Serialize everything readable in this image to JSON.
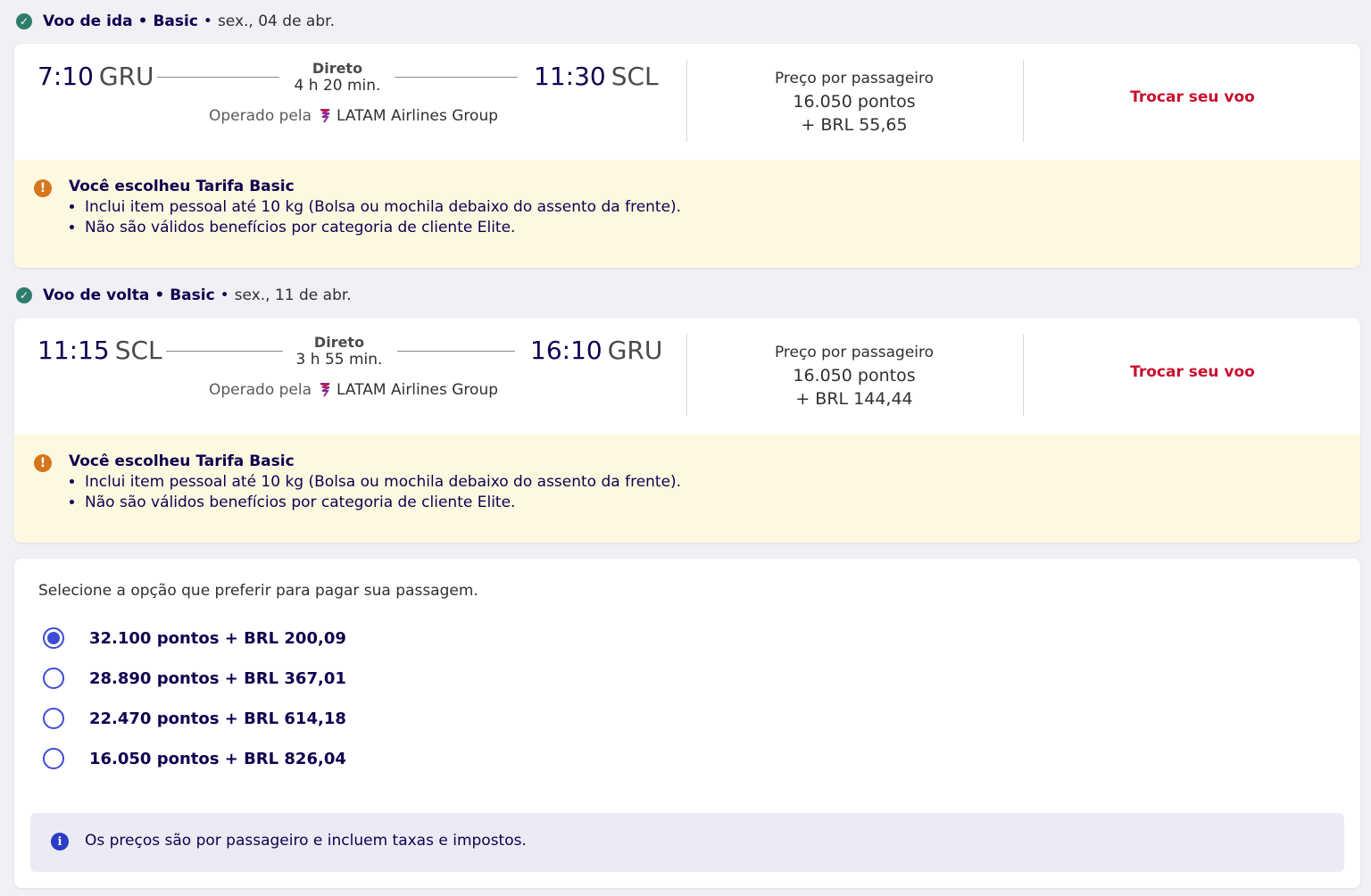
{
  "outbound": {
    "title": "Voo de ida",
    "fare": "Basic",
    "date": "sex., 04 de abr.",
    "dep_time": "7:10",
    "dep_code": "GRU",
    "arr_time": "11:30",
    "arr_code": "SCL",
    "direct_label": "Direto",
    "duration": "4 h 20 min.",
    "operated_by": "Operado pela",
    "airline": "LATAM Airlines Group",
    "price_label": "Preço por passageiro",
    "price_points": "16.050 pontos",
    "price_brl": "+ BRL 55,65",
    "change_label": "Trocar seu voo",
    "notice_title": "Você escolheu Tarifa Basic",
    "notice_items": [
      "Inclui item pessoal até 10 kg (Bolsa ou mochila debaixo do assento da frente).",
      "Não são válidos benefícios por categoria de cliente Elite."
    ]
  },
  "return": {
    "title": "Voo de volta",
    "fare": "Basic",
    "date": "sex., 11 de abr.",
    "dep_time": "11:15",
    "dep_code": "SCL",
    "arr_time": "16:10",
    "arr_code": "GRU",
    "direct_label": "Direto",
    "duration": "3 h 55 min.",
    "operated_by": "Operado pela",
    "airline": "LATAM Airlines Group",
    "price_label": "Preço por passageiro",
    "price_points": "16.050 pontos",
    "price_brl": "+ BRL 144,44",
    "change_label": "Trocar seu voo",
    "notice_title": "Você escolheu Tarifa Basic",
    "notice_items": [
      "Inclui item pessoal até 10 kg (Bolsa ou mochila debaixo do assento da frente).",
      "Não são válidos benefícios por categoria de cliente Elite."
    ]
  },
  "payment": {
    "title": "Selecione a opção que preferir para pagar sua passagem.",
    "options": [
      {
        "label": "32.100 pontos + BRL 200,09",
        "selected": true
      },
      {
        "label": "28.890 pontos + BRL 367,01",
        "selected": false
      },
      {
        "label": "22.470 pontos + BRL 614,18",
        "selected": false
      },
      {
        "label": "16.050 pontos + BRL 826,04",
        "selected": false
      }
    ],
    "info": "Os preços são por passageiro e incluem taxas e impostos."
  },
  "colors": {
    "primary": "#1b0088",
    "accent_red": "#c8102e",
    "radio": "#3e4bd6",
    "notice_bg": "#fff8e1"
  },
  "icons": {
    "check": "check-circle-icon",
    "warning": "exclamation-circle-icon",
    "info": "info-circle-icon",
    "airline": "latam-logo-icon"
  }
}
